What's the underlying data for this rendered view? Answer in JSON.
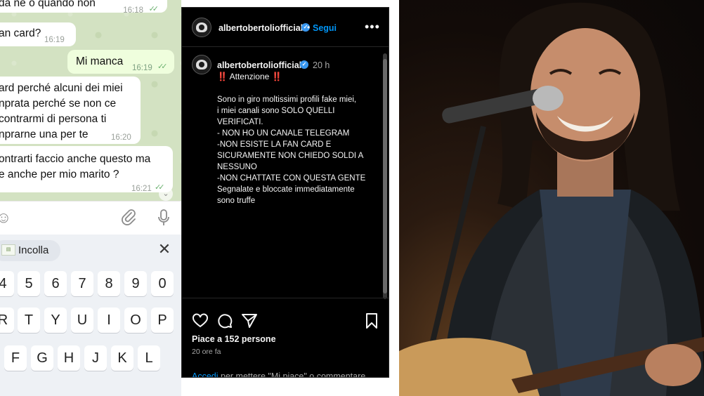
{
  "chat": {
    "messages": [
      {
        "dir": "in",
        "lines": [
          "da ne o quando non"
        ],
        "time": "16:18"
      },
      {
        "dir": "in",
        "lines": [
          "an card?"
        ],
        "time": "16:19"
      },
      {
        "dir": "out",
        "lines": [
          "Mi manca"
        ],
        "time": "16:19"
      },
      {
        "dir": "in",
        "lines": [
          "ard perché alcuni dei miei",
          "nprata perché se non ce",
          "contrarmi di persona ti",
          "nprarne una per te"
        ],
        "time": "16:20"
      },
      {
        "dir": "in",
        "lines": [
          "ontrarti faccio anche questo ma",
          "e anche per mio marito ?"
        ],
        "time": "16:21"
      }
    ]
  },
  "keyboard": {
    "paste_label": "Incolla",
    "row_numbers": [
      "4",
      "5",
      "6",
      "7",
      "8",
      "9",
      "0"
    ],
    "row_top": [
      "R",
      "T",
      "Y",
      "U",
      "I",
      "O",
      "P"
    ],
    "row_mid": [
      "F",
      "G",
      "H",
      "J",
      "K",
      "L"
    ]
  },
  "instagram": {
    "username": "albertobertoliofficial",
    "follow_label": "Segui",
    "dot": "•",
    "more": "•••",
    "post_time": "20 h",
    "caption_head": "‼️ Attenzione ‼️",
    "caption_body": "Sono in giro moltissimi profili fake miei,\ni miei canali sono SOLO QUELLI\nVERIFICATI.\n- NON HO UN CANALE TELEGRAM\n-NON ESISTE LA FAN CARD E\nSICURAMENTE NON CHIEDO SOLDI A\nNESSUNO\n-NON CHATTATE CON QUESTA GENTE\nSegnalate e bloccate immediatamente\nsono truffe",
    "likes": "Piace a 152 persone",
    "ago": "20 ore fa",
    "login_link": "Accedi",
    "login_rest": " per mettere \"Mi piace\" o commentare."
  },
  "colors": {
    "link_blue": "#0095f6",
    "verified_blue": "#3897f0",
    "chat_out": "#effedd",
    "chat_bg": "#d3e2c2"
  }
}
